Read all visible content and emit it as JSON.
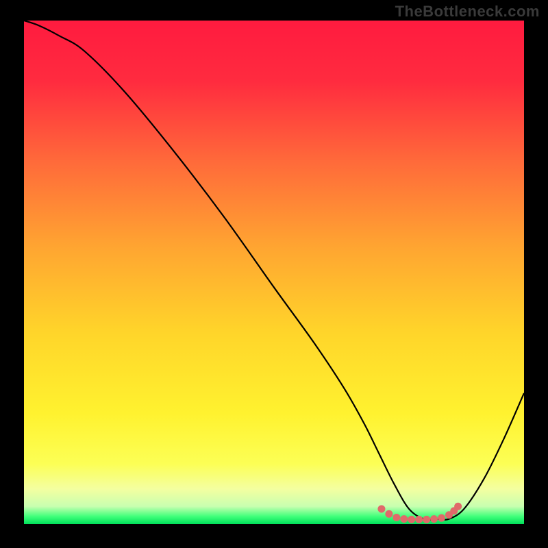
{
  "watermark": "TheBottleneck.com",
  "chart_data": {
    "type": "line",
    "title": "",
    "xlabel": "",
    "ylabel": "",
    "xlim": [
      0,
      100
    ],
    "ylim": [
      0,
      100
    ],
    "background_gradient": {
      "stops": [
        {
          "offset": 0.0,
          "color": "#ff1b3f"
        },
        {
          "offset": 0.12,
          "color": "#ff2b3f"
        },
        {
          "offset": 0.28,
          "color": "#ff6a3a"
        },
        {
          "offset": 0.45,
          "color": "#ffa531"
        },
        {
          "offset": 0.62,
          "color": "#ffd52a"
        },
        {
          "offset": 0.78,
          "color": "#fff22f"
        },
        {
          "offset": 0.88,
          "color": "#fcff55"
        },
        {
          "offset": 0.93,
          "color": "#f4ffa0"
        },
        {
          "offset": 0.965,
          "color": "#c8ffb0"
        },
        {
          "offset": 0.985,
          "color": "#40ff7a"
        },
        {
          "offset": 1.0,
          "color": "#00e05a"
        }
      ]
    },
    "series": [
      {
        "name": "bottleneck-curve",
        "color": "#000000",
        "x": [
          0,
          3,
          7,
          12,
          20,
          30,
          40,
          50,
          58,
          64,
          68,
          71,
          74,
          77,
          80,
          83,
          85,
          88,
          92,
          96,
          100
        ],
        "y": [
          100,
          99,
          97,
          94,
          86,
          74,
          61,
          47,
          36,
          27,
          20,
          14,
          8,
          3,
          1,
          1,
          1,
          3,
          9,
          17,
          26
        ]
      }
    ],
    "markers": {
      "name": "optimal-range-dots",
      "color": "#e06a6a",
      "points": [
        {
          "x": 71.5,
          "y": 3.0
        },
        {
          "x": 73.0,
          "y": 2.0
        },
        {
          "x": 74.5,
          "y": 1.3
        },
        {
          "x": 76.0,
          "y": 1.0
        },
        {
          "x": 77.5,
          "y": 0.9
        },
        {
          "x": 79.0,
          "y": 0.9
        },
        {
          "x": 80.5,
          "y": 0.9
        },
        {
          "x": 82.0,
          "y": 1.0
        },
        {
          "x": 83.5,
          "y": 1.2
        },
        {
          "x": 85.0,
          "y": 1.8
        },
        {
          "x": 86.0,
          "y": 2.6
        },
        {
          "x": 86.8,
          "y": 3.5
        }
      ]
    }
  }
}
